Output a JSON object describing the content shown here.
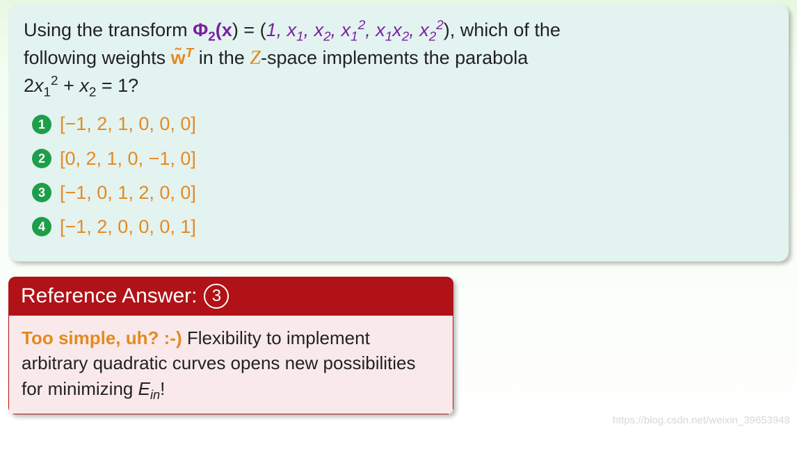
{
  "question": {
    "line1_pre": "Using the transform ",
    "phi_symbol": "Φ",
    "phi_sub": "2",
    "lparen": "(",
    "bold_x": "x",
    "rparen_eq": ") = (",
    "transform_items": [
      "1",
      "x₁",
      "x₂",
      "x₁²",
      "x₁x₂",
      "x₂²"
    ],
    "line1_post": "), which of the",
    "line2_pre": "following weights ",
    "w_tilde": "w̃",
    "w_sup": "T",
    "line2_mid": " in the ",
    "z_letter": "Z",
    "line2_post": "-space implements the parabola",
    "line3": "2x₁² + x₂ = 1?"
  },
  "options": [
    {
      "num": "1",
      "text": "[−1, 2, 1, 0, 0, 0]"
    },
    {
      "num": "2",
      "text": "[0, 2, 1, 0, −1, 0]"
    },
    {
      "num": "3",
      "text": "[−1, 0, 1, 2, 0, 0]"
    },
    {
      "num": "4",
      "text": "[−1, 2, 0, 0, 0, 1]"
    }
  ],
  "answer": {
    "header_label": "Reference Answer:",
    "correct": "3",
    "highlight": "Too simple, uh? :-)",
    "body_rest": " Flexibility to implement arbitrary quadratic curves opens new possibilities for minimizing ",
    "e_symbol": "E",
    "e_sub": "in",
    "body_end": "!"
  },
  "watermark": "https://blog.csdn.net/weixin_39653948"
}
